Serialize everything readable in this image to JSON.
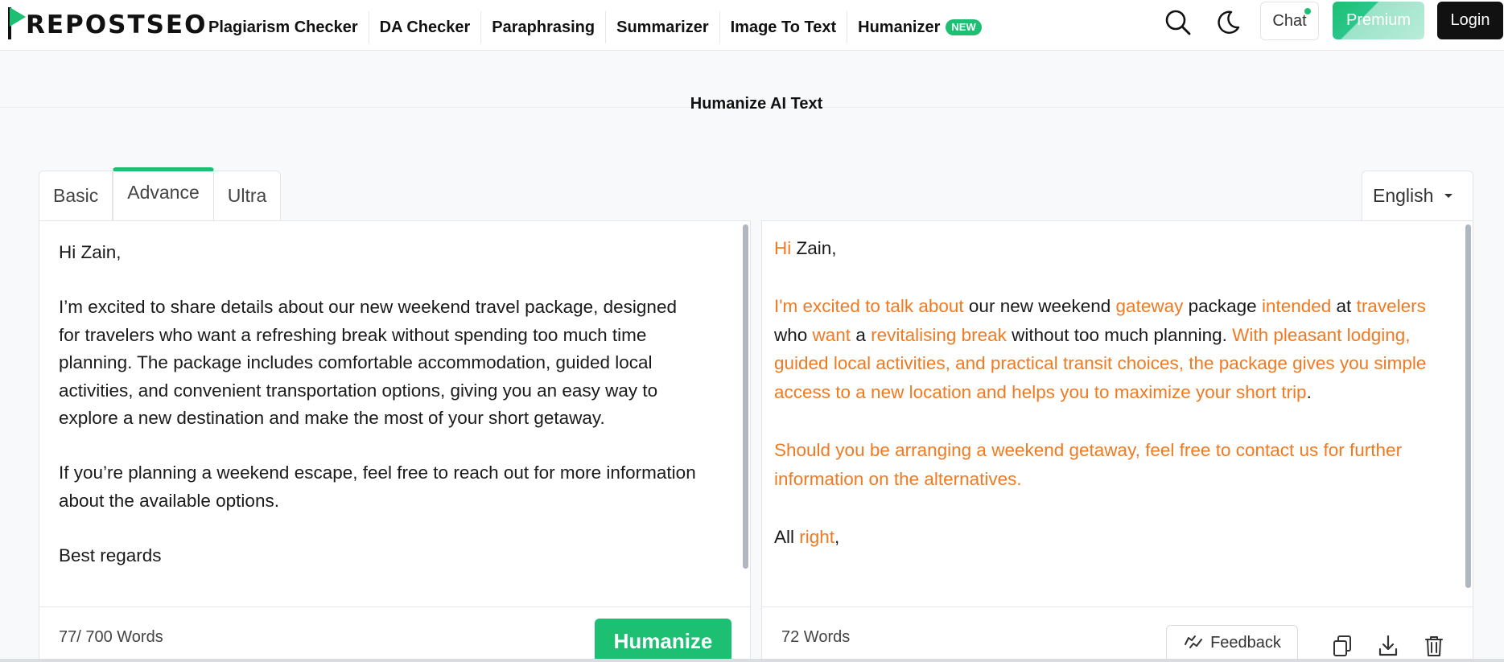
{
  "header": {
    "logo_text": "REPOSTSEO",
    "nav": [
      {
        "label": "Plagiarism Checker"
      },
      {
        "label": "DA Checker"
      },
      {
        "label": "Paraphrasing"
      },
      {
        "label": "Summarizer"
      },
      {
        "label": "Image To Text"
      },
      {
        "label": "Humanizer",
        "badge": "NEW"
      }
    ],
    "chat_label": "Chat",
    "premium_label": "Premium",
    "login_label": "Login"
  },
  "page_title": "Humanize AI Text",
  "tabs": [
    {
      "label": "Basic",
      "active": false
    },
    {
      "label": "Advance",
      "active": true
    },
    {
      "label": "Ultra",
      "active": false
    }
  ],
  "language": "English",
  "input": {
    "paragraphs": [
      "Hi Zain,",
      "I’m excited to share details about our new weekend travel package, designed for travelers who want a refreshing break without spending too much time planning. The package includes comfortable accommodation, guided local activities, and convenient transportation options, giving you an easy way to explore a new destination and make the most of your short getaway.",
      "If you’re planning a weekend escape, feel free to reach out for more information about the available options.",
      "Best regards"
    ],
    "word_count": "77/ 700 Words",
    "humanize_label": "Humanize"
  },
  "output": {
    "paragraphs": [
      [
        {
          "t": "Hi",
          "c": true
        },
        {
          "t": " Zain,",
          "c": false
        }
      ],
      [
        {
          "t": "I'm excited to talk about",
          "c": true
        },
        {
          "t": " our new weekend ",
          "c": false
        },
        {
          "t": "gateway",
          "c": true
        },
        {
          "t": " package ",
          "c": false
        },
        {
          "t": "intended",
          "c": true
        },
        {
          "t": " at ",
          "c": false
        },
        {
          "t": "travelers",
          "c": true
        },
        {
          "t": " who ",
          "c": false
        },
        {
          "t": "want",
          "c": true
        },
        {
          "t": " a ",
          "c": false
        },
        {
          "t": "revitalising break",
          "c": true
        },
        {
          "t": " without too much planning. ",
          "c": false
        },
        {
          "t": "With pleasant lodging, guided local activities, and practical transit choices, the package gives you simple access to a new location and helps you to maximize your short trip",
          "c": true
        },
        {
          "t": ".",
          "c": false
        }
      ],
      [
        {
          "t": "Should you be arranging a weekend getaway, feel free to contact us for further information on the alternatives.",
          "c": true
        }
      ],
      [
        {
          "t": "All ",
          "c": false
        },
        {
          "t": "right",
          "c": true
        },
        {
          "t": ",",
          "c": false
        }
      ]
    ],
    "word_count": "72 Words",
    "feedback_label": "Feedback"
  },
  "colors": {
    "accent": "#1dbf73",
    "changed_text": "#f07a21"
  },
  "icons": [
    "search-icon",
    "moon-icon",
    "feedback-icon",
    "copy-icon",
    "download-icon",
    "trash-icon"
  ]
}
